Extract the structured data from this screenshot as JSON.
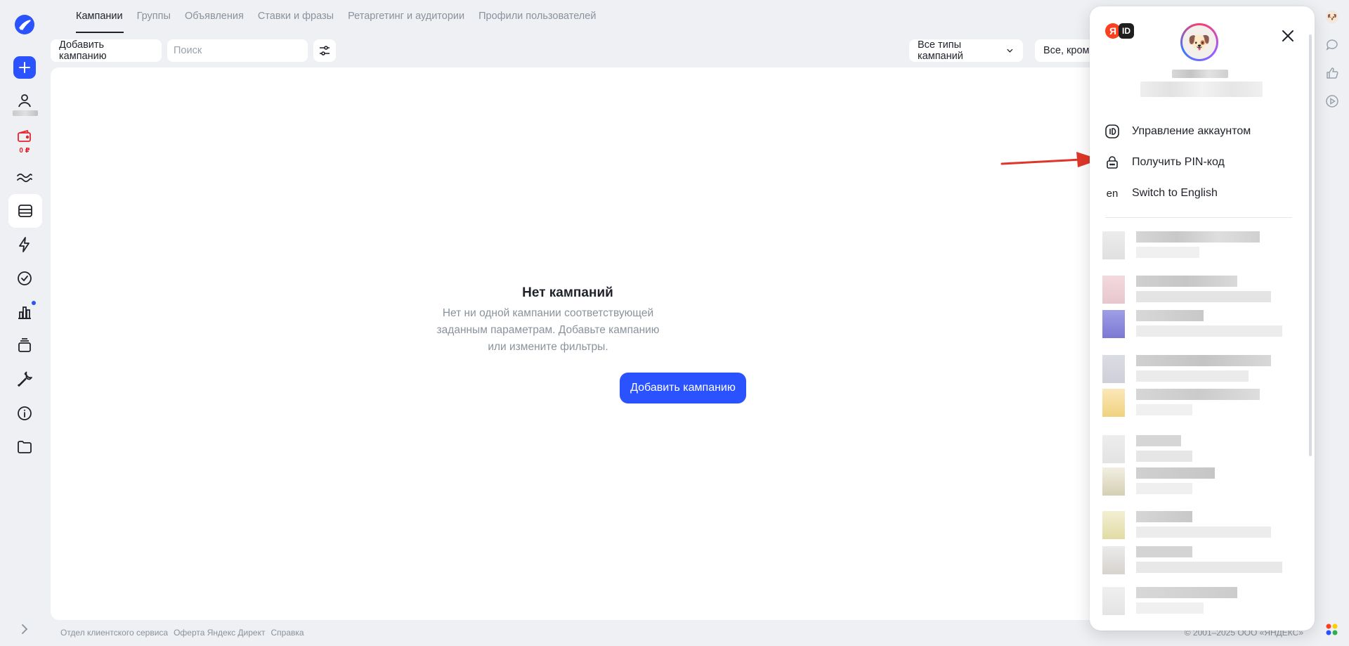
{
  "tabs": [
    "Кампании",
    "Группы",
    "Объявления",
    "Ставки и фразы",
    "Ретаргетинг и аудитории",
    "Профили пользователей"
  ],
  "toolbar": {
    "add_campaign": "Добавить кампанию",
    "search_placeholder": "Поиск",
    "campaign_types": "Все типы кампаний",
    "status_filter": "Все, кроме"
  },
  "sidebar": {
    "balance": "0 ₽",
    "items": [
      "home-icon",
      "user-icon",
      "wallet-icon",
      "stats-icon",
      "campaigns-icon",
      "lightning-icon",
      "check-icon",
      "chart-icon",
      "layers-icon",
      "tools-icon",
      "info-icon",
      "folder-icon"
    ]
  },
  "empty_state": {
    "title": "Нет кампаний",
    "text": "Нет ни одной кампании соответствующей заданным параметрам. Добавьте кампанию или измените фильтры.",
    "button": "Добавить кампанию"
  },
  "footer": {
    "links": [
      "Отдел клиентского сервиса",
      "Оферта Яндекс Директ",
      "Справка"
    ],
    "copyright": "© 2001–2025 ООО «ЯНДЕКС»"
  },
  "account_panel": {
    "badge_ya": "Я",
    "badge_id": "ID",
    "menu": {
      "manage_account": "Управление аккаунтом",
      "pin_code": "Получить PIN-код",
      "language_code": "en",
      "switch_language": "Switch to English"
    }
  },
  "colors": {
    "accent": "#2a52ff",
    "background": "#eef0f4",
    "alert": "#e5252e"
  }
}
